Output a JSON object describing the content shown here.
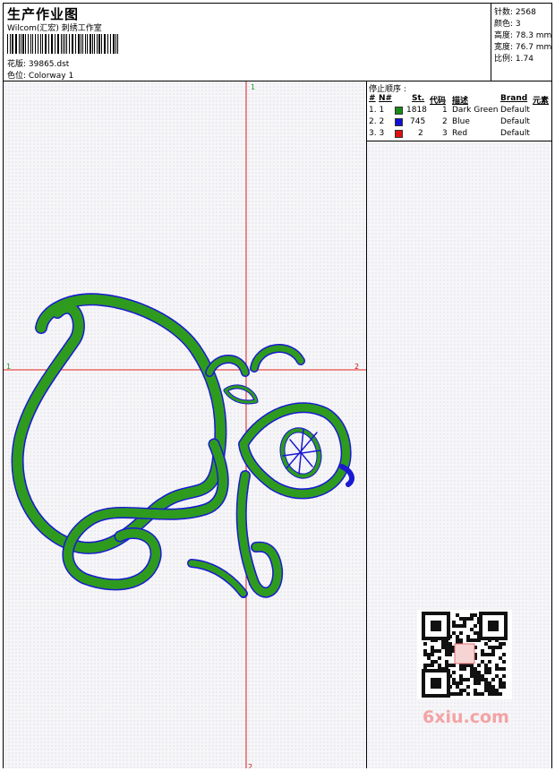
{
  "header": {
    "title": "生产作业图",
    "company": "Wilcom(汇宏) 刺绣工作室",
    "pattern_label": "花版: 39865.dst",
    "colorway_label": "色位:  Colorway 1"
  },
  "stats": {
    "stitches": "针数: 2568",
    "colors": "颜色: 3",
    "height": "高度: 78.3 mm",
    "width": "宽度: 76.7 mm",
    "ratio": "比例: 1.74"
  },
  "stop_sequence": {
    "title": "停止顺序 :",
    "headers": [
      "#",
      "N#",
      "St.",
      "代码",
      "描述",
      "Brand",
      "元素"
    ],
    "rows": [
      {
        "num": "1. 1",
        "stitches": "1818",
        "code": "1",
        "desc": "Dark Green",
        "brand": "Default",
        "color": "#1a8a1a"
      },
      {
        "num": "2. 2",
        "stitches": "745",
        "code": "2",
        "desc": "Blue",
        "brand": "Default",
        "color": "#1010d0"
      },
      {
        "num": "3. 3",
        "stitches": "2",
        "code": "3",
        "desc": "Red",
        "brand": "Default",
        "color": "#e01010"
      }
    ]
  },
  "axis": {
    "top": "1",
    "left": "1",
    "right": "2",
    "bottom": "2"
  },
  "colors": {
    "green": "#2e9b1f",
    "blue": "#1a1ad0",
    "red": "#e01010"
  },
  "watermark": "6xiu.com"
}
